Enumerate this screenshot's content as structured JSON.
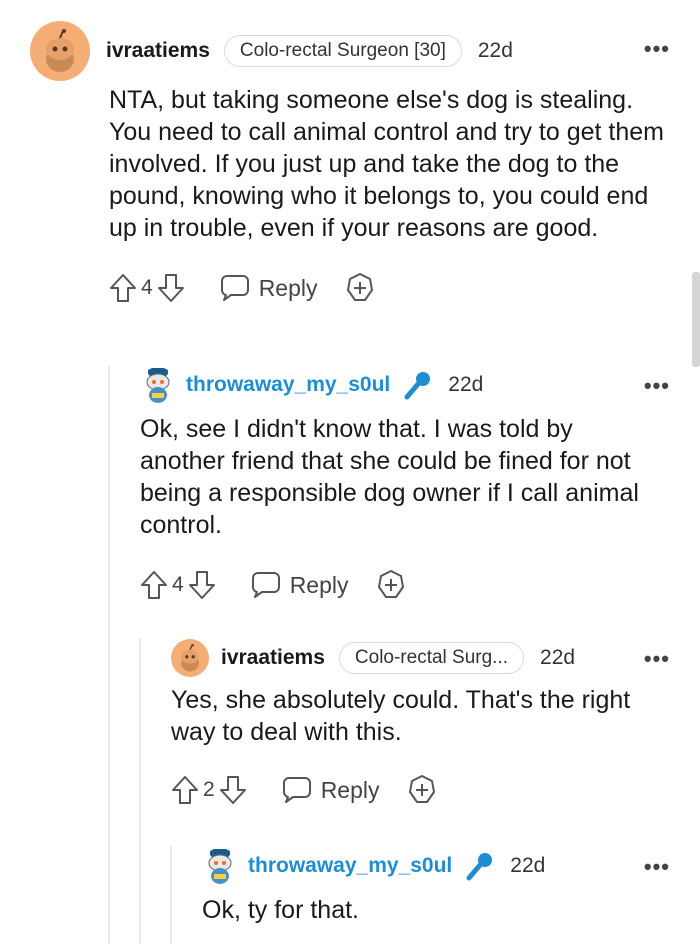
{
  "colors": {
    "username_blue": "#1f8ed1",
    "avatar_orange": "#f4ad74",
    "thread_line": "#e9eaeb"
  },
  "comments": [
    {
      "username": "ivraatiems",
      "flair": "Colo-rectal Surgeon [30]",
      "time": "22d",
      "more": "•••",
      "body": "NTA, but taking someone else's dog is stealing. You need to call animal control and try to get them involved. If you just up and take the dog to the pound, knowing who it belongs to, you could end up in trouble, even if your reasons are good.",
      "score": "4",
      "reply_label": "Reply",
      "avatar_icon": "snoo-avatar-orange"
    },
    {
      "username": "throwaway_my_s0ul",
      "time": "22d",
      "more": "•••",
      "body": "Ok, see I didn't know that. I was told by another friend that she could be fined for not being a responsible dog owner if I call animal control.",
      "score": "4",
      "reply_label": "Reply",
      "avatar_icon": "snoo-avatar-custom",
      "badge_icon": "microphone-icon"
    },
    {
      "username": "ivraatiems",
      "flair": "Colo-rectal Surg...",
      "time": "22d",
      "more": "•••",
      "body": "Yes, she absolutely could. That's the right way to deal with this.",
      "score": "2",
      "reply_label": "Reply",
      "avatar_icon": "snoo-avatar-orange"
    },
    {
      "username": "throwaway_my_s0ul",
      "time": "22d",
      "more": "•••",
      "body": "Ok, ty for that.",
      "avatar_icon": "snoo-avatar-custom",
      "badge_icon": "microphone-icon"
    }
  ]
}
